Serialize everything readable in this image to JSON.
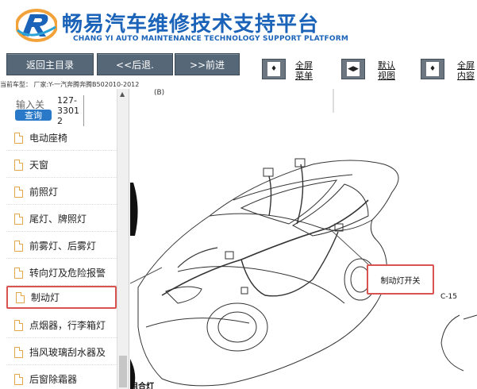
{
  "header": {
    "title_cn": "畅易汽车维修技术支持平台",
    "title_en": "CHANG YI AUTO MAINTENANCE TECHNOLOGY SUPPORT PLATFORM",
    "logo_icon": "ry-logo-icon",
    "accent_color": "#1a63b8"
  },
  "toolbar": {
    "back_main": "返回主目录",
    "back": "<<后退.",
    "forward": ">>前进",
    "fullscreen_menu_line1": "全屏",
    "fullscreen_menu_line2": "菜单",
    "default_view_line1": "默认",
    "default_view_line2": "视图",
    "fullscreen_content_line1": "全屏",
    "fullscreen_content_line2": "内容",
    "icons": [
      "expand-menu-icon",
      "default-view-icon",
      "expand-content-icon"
    ]
  },
  "model_line": "当前车型：  厂家:Y-一汽奔腾奔腾B502010-2012",
  "sidebar": {
    "search_label": "输入关",
    "search_code": "127-33012",
    "query_button": "查询",
    "items": [
      {
        "label": "电动座椅"
      },
      {
        "label": "天窗"
      },
      {
        "label": "前照灯"
      },
      {
        "label": "尾灯、牌照灯"
      },
      {
        "label": "前雾灯、后雾灯"
      },
      {
        "label": "转向灯及危险报警"
      },
      {
        "label": "制动灯"
      },
      {
        "label": "点烟器，行李箱灯"
      },
      {
        "label": "挡风玻璃刮水器及"
      },
      {
        "label": "后窗除霜器"
      }
    ],
    "active_index": 6,
    "highlight_color": "#d9534f"
  },
  "diagram": {
    "ref_text": "(B)",
    "callout_label": "制动灯开关",
    "connector_label": "C-15",
    "bottom_label": "组合灯"
  }
}
